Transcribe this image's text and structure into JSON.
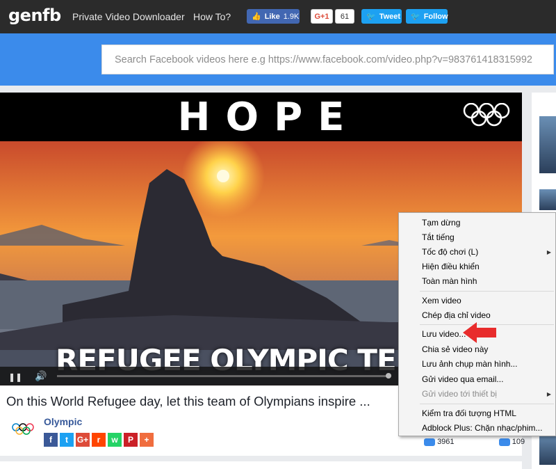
{
  "topbar": {
    "logo": "genfb",
    "links": [
      "Private Video Downloader",
      "How To?"
    ],
    "fb_like": {
      "label": "Like",
      "count": "1.9K"
    },
    "gplus": {
      "label": "G+1",
      "count": "61"
    },
    "tweet_label": "Tweet",
    "follow_label": "Follow"
  },
  "search": {
    "placeholder": "Search Facebook videos here e.g https://www.facebook.com/video.php?v=983761418315992"
  },
  "video": {
    "overlay_top": "HOPE",
    "overlay_bottom": "REFUGEE OLYMPIC TE",
    "title": "On this World Refugee day, let this team of Olympians inspire ...",
    "author": "Olympic",
    "stats": {
      "likes": "3961",
      "shares": "",
      "comments": "109"
    }
  },
  "share_buttons": [
    {
      "icon": "facebook-icon",
      "glyph": "f",
      "color": "#3b5998"
    },
    {
      "icon": "twitter-icon",
      "glyph": "t",
      "color": "#1da1f2"
    },
    {
      "icon": "googleplus-icon",
      "glyph": "G+",
      "color": "#dd4b39"
    },
    {
      "icon": "reddit-icon",
      "glyph": "r",
      "color": "#ff4500"
    },
    {
      "icon": "whatsapp-icon",
      "glyph": "w",
      "color": "#25d366"
    },
    {
      "icon": "pinterest-icon",
      "glyph": "P",
      "color": "#cb2027"
    },
    {
      "icon": "more-icon",
      "glyph": "+",
      "color": "#f06d3e"
    }
  ],
  "context_menu": {
    "items": [
      {
        "label": "Tạm dừng"
      },
      {
        "label": "Tắt tiếng"
      },
      {
        "label": "Tốc độ chơi (L)",
        "submenu": true
      },
      {
        "label": "Hiện điều khiển"
      },
      {
        "label": "Toàn màn hình"
      },
      {
        "label": "Xem video"
      },
      {
        "label": "Chép địa chỉ video"
      },
      {
        "label": "Lưu video..."
      },
      {
        "label": "Chia sẻ video này"
      },
      {
        "label": "Lưu ảnh chụp màn hình..."
      },
      {
        "label": "Gửi video qua email..."
      },
      {
        "label": "Gửi video tới thiết bị",
        "submenu": true,
        "disabled": true
      },
      {
        "label": "Kiểm tra đối tượng HTML"
      },
      {
        "label": "Adblock Plus: Chặn nhạc/phim..."
      }
    ]
  },
  "colors": {
    "accent": "#3b8beb",
    "topbar": "#2b2b2b",
    "highlight_arrow": "#e82c2c"
  }
}
